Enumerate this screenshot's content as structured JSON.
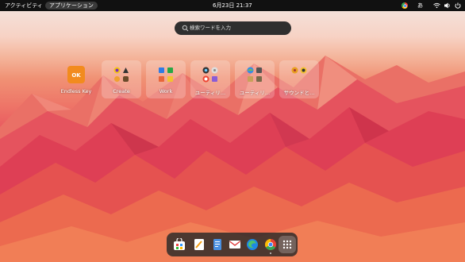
{
  "topbar": {
    "activities": "アクティビティ",
    "applications": "アプリケーション",
    "clock": "6月23日 21:37",
    "input_method": "あ"
  },
  "search": {
    "placeholder": "検索ワードを入力"
  },
  "apps": [
    {
      "label": "Endless Key",
      "type": "app",
      "icon": "endless-key-icon"
    },
    {
      "label": "Create",
      "type": "folder",
      "icon": "folder-icon"
    },
    {
      "label": "Work",
      "type": "folder",
      "icon": "folder-icon"
    },
    {
      "label": "ユーティリ…",
      "type": "folder",
      "icon": "folder-icon"
    },
    {
      "label": "ユーティリ…",
      "type": "folder",
      "icon": "folder-icon"
    },
    {
      "label": "サウンドと…",
      "type": "folder",
      "icon": "folder-icon"
    }
  ],
  "dock": {
    "items": [
      "software-store-icon",
      "text-editor-icon",
      "documents-icon",
      "mail-icon",
      "edge-browser-icon",
      "chrome-browser-icon",
      "show-apps-icon"
    ]
  },
  "colors": {
    "topbar_bg": "#111111",
    "search_bg": "#2f2f2f",
    "dock_bg": "#282828",
    "wallpaper_accent": "#e6485a"
  }
}
